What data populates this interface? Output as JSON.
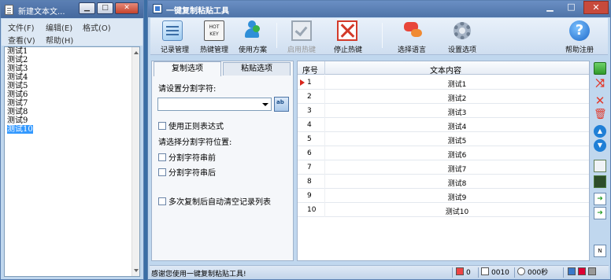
{
  "notepad": {
    "title": "新建文本文...",
    "menu": [
      "文件(F)",
      "编辑(E)",
      "格式(O)",
      "查看(V)",
      "帮助(H)"
    ],
    "lines": [
      "测试1",
      "测试2",
      "测试3",
      "测试4",
      "测试5",
      "测试6",
      "测试7",
      "测试8",
      "测试9",
      "测试10"
    ],
    "selected_line": "测试10"
  },
  "app": {
    "title": "一键复制粘贴工具",
    "toolbar": [
      {
        "label": "记录管理",
        "icon": "record-icon",
        "enabled": true
      },
      {
        "label": "热键管理",
        "icon": "hotkey-icon",
        "enabled": true
      },
      {
        "label": "使用方案",
        "icon": "users-icon",
        "enabled": true
      },
      {
        "label": "启用热键",
        "icon": "check-icon",
        "enabled": false
      },
      {
        "label": "停止热键",
        "icon": "stop-icon",
        "enabled": true
      },
      {
        "label": "选择语言",
        "icon": "chat-bubble-icon",
        "enabled": true
      },
      {
        "label": "设置选项",
        "icon": "gear-icon",
        "enabled": true
      },
      {
        "label": "帮助注册",
        "icon": "help-icon",
        "enabled": true
      }
    ],
    "hotkey_icon_text": "HOT KEY",
    "tabs": [
      "复制选项",
      "粘贴选项"
    ],
    "options": {
      "separator_label": "请设置分割字符:",
      "separator_value": "",
      "regex_label": "使用正则表达式",
      "position_label": "请选择分割字符位置:",
      "before_label": "分割字符串前",
      "after_label": "分割字符串后",
      "autoclear_label": "多次复制后自动清空记录列表"
    },
    "grid": {
      "headers": [
        "序号",
        "文本内容"
      ],
      "rows": [
        {
          "n": "1",
          "v": "测试1"
        },
        {
          "n": "2",
          "v": "测试2"
        },
        {
          "n": "3",
          "v": "测试3"
        },
        {
          "n": "4",
          "v": "测试4"
        },
        {
          "n": "5",
          "v": "测试5"
        },
        {
          "n": "6",
          "v": "测试6"
        },
        {
          "n": "7",
          "v": "测试7"
        },
        {
          "n": "8",
          "v": "测试8"
        },
        {
          "n": "9",
          "v": "测试9"
        },
        {
          "n": "10",
          "v": "测试10"
        }
      ]
    },
    "status": {
      "message": "感谢您使用一键复制粘贴工具!",
      "count": "0",
      "digits": "0010",
      "seconds": "000秒"
    }
  }
}
